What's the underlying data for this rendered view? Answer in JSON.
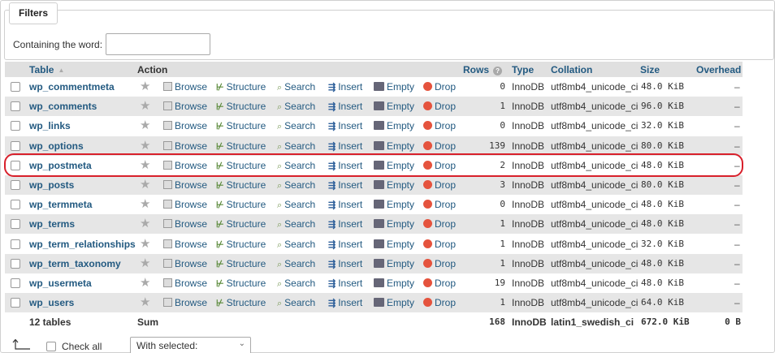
{
  "filters": {
    "legend": "Filters",
    "label": "Containing the word:",
    "value": ""
  },
  "columns": {
    "table": "Table",
    "action": "Action",
    "rows": "Rows",
    "type": "Type",
    "collation": "Collation",
    "size": "Size",
    "overhead": "Overhead"
  },
  "actions": {
    "browse": "Browse",
    "structure": "Structure",
    "search": "Search",
    "insert": "Insert",
    "empty": "Empty",
    "drop": "Drop"
  },
  "tables": [
    {
      "name": "wp_commentmeta",
      "rows": "0",
      "type": "InnoDB",
      "collation": "utf8mb4_unicode_ci",
      "size": "48.0 KiB",
      "overhead": "–"
    },
    {
      "name": "wp_comments",
      "rows": "1",
      "type": "InnoDB",
      "collation": "utf8mb4_unicode_ci",
      "size": "96.0 KiB",
      "overhead": "–"
    },
    {
      "name": "wp_links",
      "rows": "0",
      "type": "InnoDB",
      "collation": "utf8mb4_unicode_ci",
      "size": "32.0 KiB",
      "overhead": "–"
    },
    {
      "name": "wp_options",
      "rows": "139",
      "type": "InnoDB",
      "collation": "utf8mb4_unicode_ci",
      "size": "80.0 KiB",
      "overhead": "–"
    },
    {
      "name": "wp_postmeta",
      "rows": "2",
      "type": "InnoDB",
      "collation": "utf8mb4_unicode_ci",
      "size": "48.0 KiB",
      "overhead": "–"
    },
    {
      "name": "wp_posts",
      "rows": "3",
      "type": "InnoDB",
      "collation": "utf8mb4_unicode_ci",
      "size": "80.0 KiB",
      "overhead": "–"
    },
    {
      "name": "wp_termmeta",
      "rows": "0",
      "type": "InnoDB",
      "collation": "utf8mb4_unicode_ci",
      "size": "48.0 KiB",
      "overhead": "–"
    },
    {
      "name": "wp_terms",
      "rows": "1",
      "type": "InnoDB",
      "collation": "utf8mb4_unicode_ci",
      "size": "48.0 KiB",
      "overhead": "–"
    },
    {
      "name": "wp_term_relationships",
      "rows": "1",
      "type": "InnoDB",
      "collation": "utf8mb4_unicode_ci",
      "size": "32.0 KiB",
      "overhead": "–"
    },
    {
      "name": "wp_term_taxonomy",
      "rows": "1",
      "type": "InnoDB",
      "collation": "utf8mb4_unicode_ci",
      "size": "48.0 KiB",
      "overhead": "–"
    },
    {
      "name": "wp_usermeta",
      "rows": "19",
      "type": "InnoDB",
      "collation": "utf8mb4_unicode_ci",
      "size": "48.0 KiB",
      "overhead": "–"
    },
    {
      "name": "wp_users",
      "rows": "1",
      "type": "InnoDB",
      "collation": "utf8mb4_unicode_ci",
      "size": "64.0 KiB",
      "overhead": "–"
    }
  ],
  "summary": {
    "count": "12 tables",
    "sum": "Sum",
    "rows": "168",
    "type": "InnoDB",
    "collation": "latin1_swedish_ci",
    "size": "672.0 KiB",
    "overhead": "0 B"
  },
  "footer": {
    "check_all": "Check all",
    "with_selected": "With selected:"
  },
  "colors": {
    "link": "#235a81",
    "highlight": "#d8202b",
    "drop": "#e5533d"
  }
}
